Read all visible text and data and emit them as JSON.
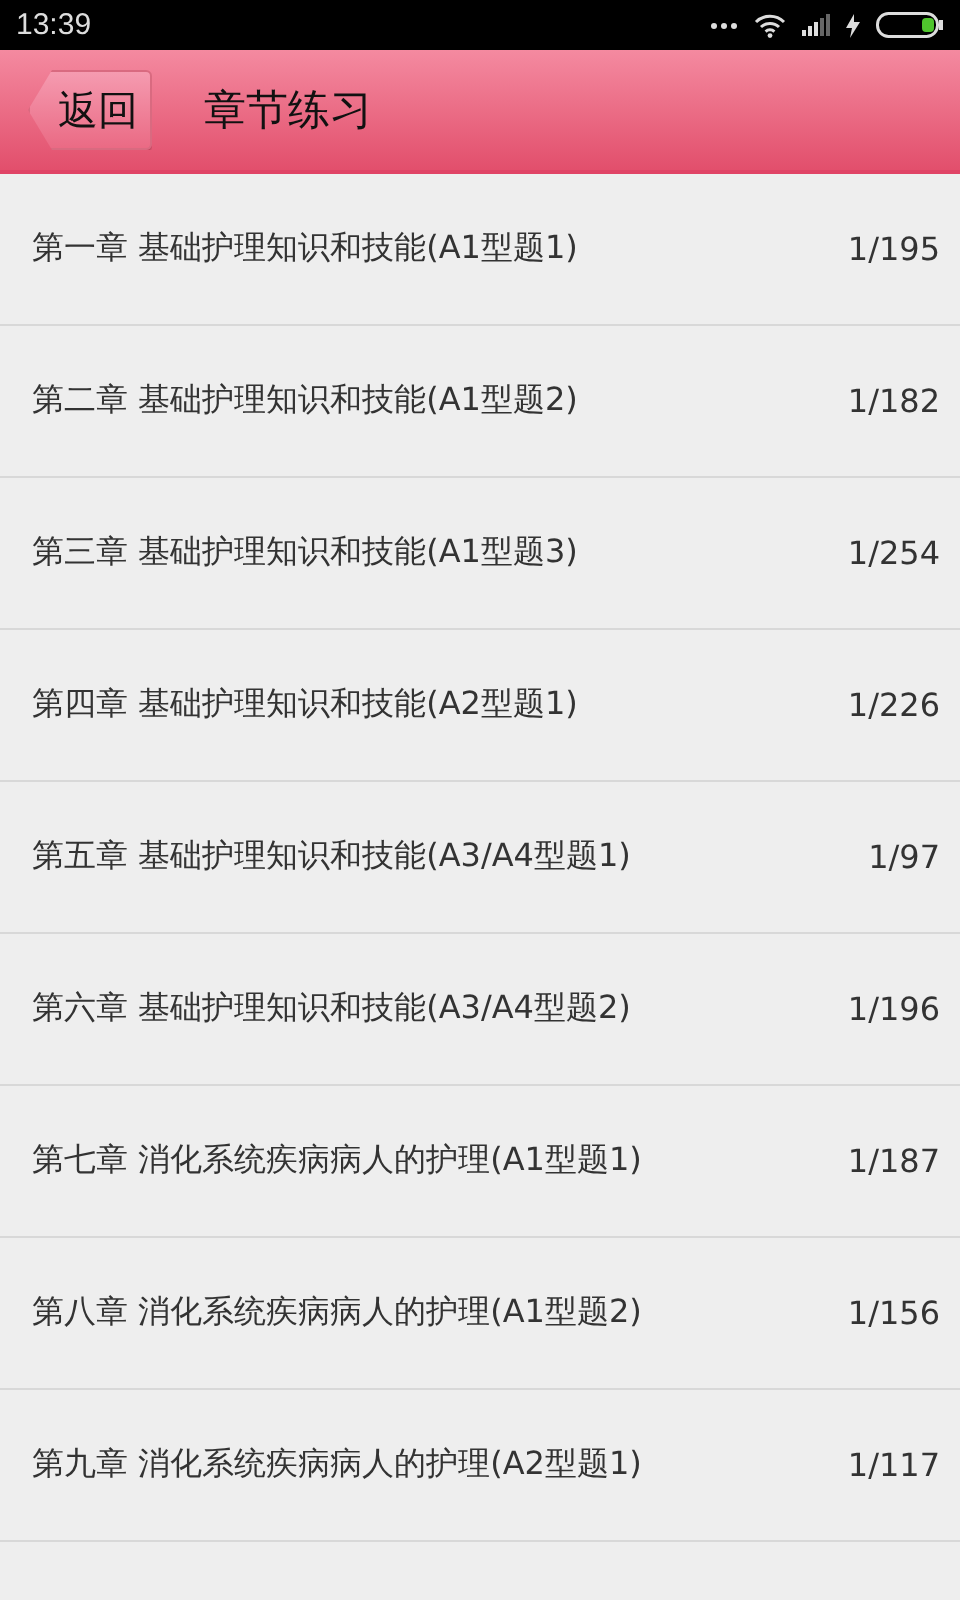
{
  "status_bar": {
    "time": "13:39"
  },
  "header": {
    "back": "返回",
    "title": "章节练习"
  },
  "chapters": [
    {
      "title": "第一章  基础护理知识和技能(A1型题1)",
      "progress": "1/195"
    },
    {
      "title": "第二章  基础护理知识和技能(A1型题2)",
      "progress": "1/182"
    },
    {
      "title": "第三章  基础护理知识和技能(A1型题3)",
      "progress": "1/254"
    },
    {
      "title": "第四章  基础护理知识和技能(A2型题1)",
      "progress": "1/226"
    },
    {
      "title": "第五章  基础护理知识和技能(A3/A4型题1)",
      "progress": "1/97"
    },
    {
      "title": "第六章  基础护理知识和技能(A3/A4型题2)",
      "progress": "1/196"
    },
    {
      "title": "第七章  消化系统疾病病人的护理(A1型题1)",
      "progress": "1/187"
    },
    {
      "title": "第八章  消化系统疾病病人的护理(A1型题2)",
      "progress": "1/156"
    },
    {
      "title": "第九章  消化系统疾病病人的护理(A2型题1)",
      "progress": "1/117"
    }
  ]
}
